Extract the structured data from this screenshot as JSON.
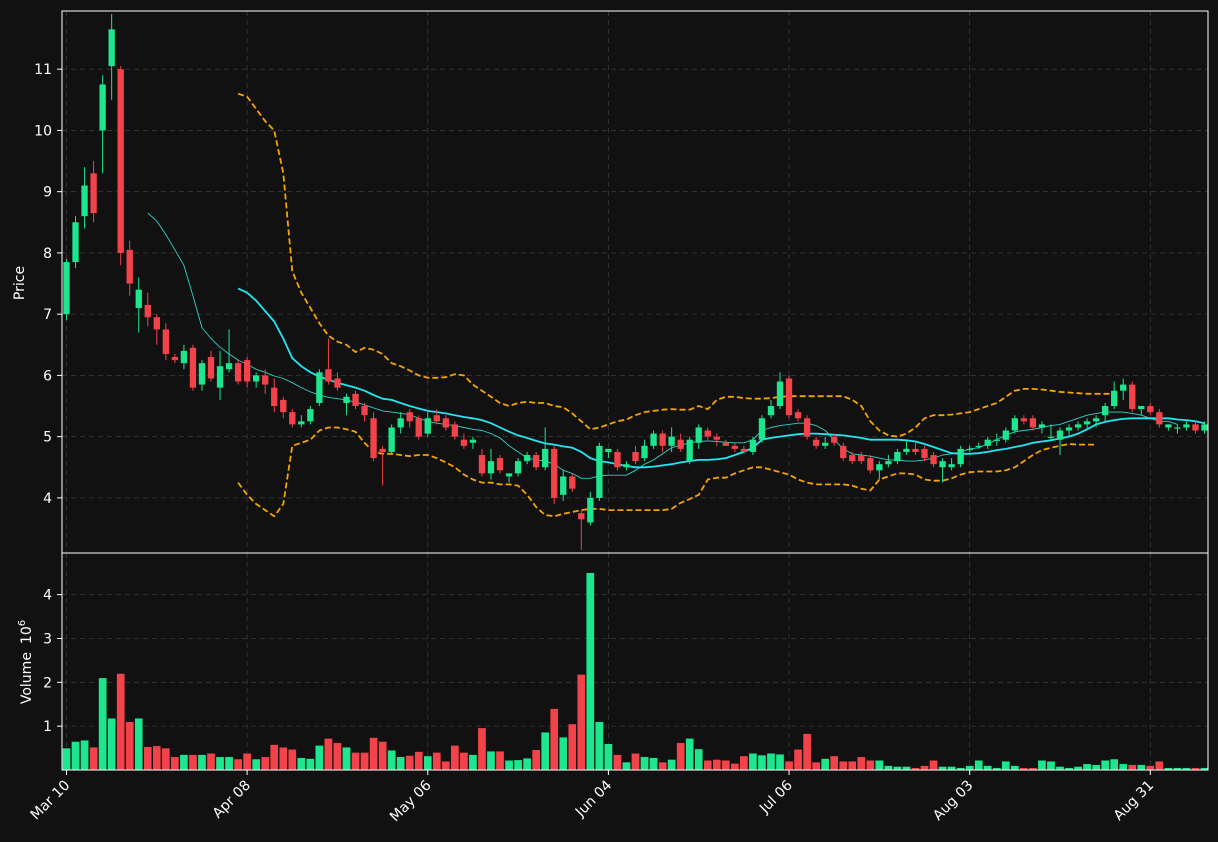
{
  "chart_data": {
    "type": "candlestick",
    "colors": {
      "background": "#111111",
      "grid": "#3a3a3a",
      "axis": "#ffffff",
      "up": "#1de68e",
      "down": "#f2424a",
      "ma_fast": "#2fd3c8",
      "ma_slow": "#22e6f2",
      "band": "#f5a300"
    },
    "price_panel": {
      "ylabel": "Price",
      "ylim": [
        3.1,
        11.95
      ],
      "yticks": [
        4,
        5,
        6,
        7,
        8,
        9,
        10,
        11
      ],
      "grid": true
    },
    "volume_panel": {
      "ylabel": "Volume",
      "ylabel_unit": "10",
      "ylabel_exp": "6",
      "ylim": [
        0,
        4.95
      ],
      "yticks": [
        1,
        2,
        3,
        4
      ],
      "grid": true
    },
    "x_ticks": [
      {
        "index": 0,
        "label": "Mar 10"
      },
      {
        "index": 20,
        "label": "Apr 08"
      },
      {
        "index": 40,
        "label": "May 06"
      },
      {
        "index": 60,
        "label": "Jun 04"
      },
      {
        "index": 80,
        "label": "Jul 06"
      },
      {
        "index": 100,
        "label": "Aug 03"
      },
      {
        "index": 120,
        "label": "Aug 31"
      }
    ],
    "n_bars": 127,
    "ohlc": [
      [
        7.0,
        7.9,
        6.9,
        7.85
      ],
      [
        7.85,
        8.6,
        7.75,
        8.5
      ],
      [
        8.6,
        9.4,
        8.4,
        9.1
      ],
      [
        9.3,
        9.5,
        8.5,
        8.65
      ],
      [
        10.0,
        10.9,
        9.3,
        10.75
      ],
      [
        11.05,
        11.9,
        10.5,
        11.65
      ],
      [
        11.0,
        11.05,
        7.8,
        8.0
      ],
      [
        8.05,
        8.2,
        7.3,
        7.5
      ],
      [
        7.1,
        7.6,
        6.7,
        7.4
      ],
      [
        7.15,
        7.35,
        6.8,
        6.95
      ],
      [
        6.95,
        7.0,
        6.5,
        6.75
      ],
      [
        6.75,
        6.85,
        6.25,
        6.35
      ],
      [
        6.3,
        6.35,
        6.2,
        6.25
      ],
      [
        6.2,
        6.5,
        6.1,
        6.4
      ],
      [
        6.45,
        6.5,
        5.75,
        5.8
      ],
      [
        5.85,
        6.25,
        5.75,
        6.2
      ],
      [
        6.3,
        6.4,
        5.9,
        5.95
      ],
      [
        5.8,
        6.4,
        5.6,
        6.15
      ],
      [
        6.1,
        6.75,
        6.05,
        6.2
      ],
      [
        6.2,
        6.25,
        5.85,
        5.9
      ],
      [
        6.25,
        6.3,
        5.8,
        5.9
      ],
      [
        5.9,
        6.05,
        5.8,
        6.0
      ],
      [
        6.0,
        6.1,
        5.7,
        5.85
      ],
      [
        5.8,
        5.95,
        5.4,
        5.5
      ],
      [
        5.6,
        5.65,
        5.3,
        5.4
      ],
      [
        5.4,
        5.45,
        5.15,
        5.2
      ],
      [
        5.2,
        5.35,
        5.15,
        5.25
      ],
      [
        5.25,
        5.5,
        5.2,
        5.45
      ],
      [
        5.55,
        6.1,
        5.5,
        6.05
      ],
      [
        6.1,
        6.6,
        5.85,
        5.9
      ],
      [
        5.95,
        6.05,
        5.75,
        5.8
      ],
      [
        5.55,
        5.7,
        5.35,
        5.65
      ],
      [
        5.7,
        5.75,
        5.45,
        5.5
      ],
      [
        5.5,
        5.55,
        5.25,
        5.35
      ],
      [
        5.3,
        5.4,
        4.6,
        4.65
      ],
      [
        4.8,
        4.85,
        4.2,
        4.75
      ],
      [
        4.75,
        5.2,
        4.7,
        5.15
      ],
      [
        5.15,
        5.4,
        5.05,
        5.3
      ],
      [
        5.4,
        5.45,
        5.15,
        5.25
      ],
      [
        5.3,
        5.35,
        4.95,
        5.0
      ],
      [
        5.05,
        5.4,
        5.0,
        5.3
      ],
      [
        5.35,
        5.45,
        5.2,
        5.25
      ],
      [
        5.3,
        5.35,
        5.1,
        5.15
      ],
      [
        5.2,
        5.25,
        4.95,
        5.0
      ],
      [
        4.95,
        5.05,
        4.8,
        4.85
      ],
      [
        4.9,
        5.0,
        4.8,
        4.95
      ],
      [
        4.7,
        4.8,
        4.35,
        4.4
      ],
      [
        4.4,
        4.8,
        4.3,
        4.6
      ],
      [
        4.65,
        4.7,
        4.4,
        4.45
      ],
      [
        4.35,
        4.4,
        4.25,
        4.4
      ],
      [
        4.4,
        4.65,
        4.35,
        4.6
      ],
      [
        4.6,
        4.75,
        4.55,
        4.7
      ],
      [
        4.7,
        4.75,
        4.45,
        4.5
      ],
      [
        4.5,
        5.15,
        4.45,
        4.8
      ],
      [
        4.8,
        4.85,
        3.9,
        4.0
      ],
      [
        4.05,
        4.45,
        3.95,
        4.35
      ],
      [
        4.35,
        4.4,
        4.1,
        4.15
      ],
      [
        3.75,
        3.8,
        3.15,
        3.65
      ],
      [
        3.6,
        4.1,
        3.55,
        4.0
      ],
      [
        4.0,
        4.9,
        3.95,
        4.85
      ],
      [
        4.75,
        4.8,
        4.65,
        4.8
      ],
      [
        4.75,
        4.8,
        4.45,
        4.5
      ],
      [
        4.5,
        4.6,
        4.45,
        4.55
      ],
      [
        4.75,
        4.85,
        4.55,
        4.6
      ],
      [
        4.65,
        4.95,
        4.6,
        4.85
      ],
      [
        4.85,
        5.1,
        4.8,
        5.05
      ],
      [
        5.05,
        5.1,
        4.75,
        4.85
      ],
      [
        4.85,
        5.15,
        4.75,
        5.0
      ],
      [
        4.95,
        5.05,
        4.75,
        4.8
      ],
      [
        4.6,
        5.0,
        4.55,
        4.95
      ],
      [
        4.9,
        5.2,
        4.8,
        5.15
      ],
      [
        5.1,
        5.15,
        4.95,
        5.0
      ],
      [
        5.0,
        5.05,
        4.85,
        4.95
      ],
      [
        4.9,
        4.95,
        4.85,
        4.85
      ],
      [
        4.85,
        4.9,
        4.75,
        4.8
      ],
      [
        4.8,
        4.85,
        4.75,
        4.75
      ],
      [
        4.75,
        5.0,
        4.7,
        4.95
      ],
      [
        4.95,
        5.35,
        4.9,
        5.3
      ],
      [
        5.35,
        5.6,
        5.3,
        5.5
      ],
      [
        5.5,
        6.05,
        5.45,
        5.9
      ],
      [
        5.95,
        6.0,
        5.3,
        5.35
      ],
      [
        5.4,
        5.45,
        5.25,
        5.3
      ],
      [
        5.3,
        5.35,
        4.95,
        5.0
      ],
      [
        4.95,
        5.0,
        4.8,
        4.85
      ],
      [
        4.85,
        5.0,
        4.8,
        4.9
      ],
      [
        5.0,
        5.05,
        4.85,
        4.9
      ],
      [
        4.85,
        4.9,
        4.6,
        4.65
      ],
      [
        4.7,
        4.75,
        4.55,
        4.6
      ],
      [
        4.7,
        4.75,
        4.55,
        4.6
      ],
      [
        4.65,
        4.7,
        4.4,
        4.45
      ],
      [
        4.45,
        4.6,
        4.3,
        4.55
      ],
      [
        4.55,
        4.7,
        4.5,
        4.6
      ],
      [
        4.6,
        4.8,
        4.55,
        4.75
      ],
      [
        4.75,
        4.95,
        4.7,
        4.8
      ],
      [
        4.8,
        4.9,
        4.7,
        4.75
      ],
      [
        4.8,
        4.85,
        4.6,
        4.65
      ],
      [
        4.7,
        4.75,
        4.5,
        4.55
      ],
      [
        4.5,
        4.65,
        4.25,
        4.6
      ],
      [
        4.5,
        4.65,
        4.45,
        4.55
      ],
      [
        4.55,
        4.85,
        4.5,
        4.8
      ],
      [
        4.8,
        4.85,
        4.75,
        4.8
      ],
      [
        4.85,
        4.9,
        4.8,
        4.85
      ],
      [
        4.85,
        5.0,
        4.8,
        4.95
      ],
      [
        4.95,
        5.05,
        4.85,
        4.95
      ],
      [
        4.95,
        5.15,
        4.9,
        5.1
      ],
      [
        5.1,
        5.35,
        5.05,
        5.3
      ],
      [
        5.3,
        5.35,
        5.2,
        5.25
      ],
      [
        5.3,
        5.35,
        5.1,
        5.15
      ],
      [
        5.15,
        5.25,
        5.05,
        5.2
      ],
      [
        5.0,
        5.2,
        4.95,
        5.0
      ],
      [
        4.95,
        5.15,
        4.7,
        5.1
      ],
      [
        5.1,
        5.2,
        5.0,
        5.15
      ],
      [
        5.15,
        5.25,
        5.1,
        5.2
      ],
      [
        5.2,
        5.3,
        5.1,
        5.25
      ],
      [
        5.25,
        5.35,
        5.15,
        5.3
      ],
      [
        5.35,
        5.55,
        5.25,
        5.5
      ],
      [
        5.5,
        5.9,
        5.45,
        5.75
      ],
      [
        5.75,
        5.95,
        5.6,
        5.85
      ],
      [
        5.85,
        5.9,
        5.4,
        5.45
      ],
      [
        5.45,
        5.5,
        5.35,
        5.5
      ],
      [
        5.5,
        5.55,
        5.35,
        5.4
      ],
      [
        5.4,
        5.45,
        5.15,
        5.2
      ],
      [
        5.15,
        5.2,
        5.1,
        5.2
      ],
      [
        5.15,
        5.2,
        5.05,
        5.15
      ],
      [
        5.15,
        5.25,
        5.1,
        5.2
      ],
      [
        5.2,
        5.25,
        5.05,
        5.1
      ],
      [
        5.1,
        5.25,
        5.05,
        5.2
      ]
    ],
    "volume": [
      0.5,
      0.65,
      0.68,
      0.52,
      2.1,
      1.18,
      2.2,
      1.1,
      1.18,
      0.53,
      0.55,
      0.5,
      0.3,
      0.35,
      0.35,
      0.35,
      0.38,
      0.3,
      0.3,
      0.25,
      0.38,
      0.25,
      0.3,
      0.58,
      0.52,
      0.47,
      0.28,
      0.26,
      0.56,
      0.72,
      0.62,
      0.52,
      0.4,
      0.4,
      0.74,
      0.65,
      0.45,
      0.3,
      0.33,
      0.42,
      0.32,
      0.4,
      0.2,
      0.56,
      0.4,
      0.35,
      0.96,
      0.43,
      0.43,
      0.22,
      0.23,
      0.27,
      0.46,
      0.86,
      1.4,
      0.75,
      1.05,
      2.18,
      4.5,
      1.1,
      0.6,
      0.35,
      0.18,
      0.38,
      0.3,
      0.28,
      0.18,
      0.24,
      0.62,
      0.72,
      0.48,
      0.22,
      0.24,
      0.22,
      0.15,
      0.32,
      0.38,
      0.34,
      0.38,
      0.36,
      0.2,
      0.47,
      0.83,
      0.18,
      0.26,
      0.32,
      0.2,
      0.2,
      0.3,
      0.22,
      0.22,
      0.1,
      0.08,
      0.08,
      0.05,
      0.1,
      0.22,
      0.08,
      0.08,
      0.05,
      0.1,
      0.22,
      0.1,
      0.05,
      0.2,
      0.1,
      0.05,
      0.05,
      0.22,
      0.2,
      0.08,
      0.05,
      0.08,
      0.14,
      0.12,
      0.22,
      0.25,
      0.14,
      0.12,
      0.12,
      0.1,
      0.2,
      0.05,
      0.05,
      0.05,
      0.05,
      0.05
    ],
    "ma_fast": {
      "start": 9,
      "values": [
        8.65,
        8.52,
        8.3,
        8.05,
        7.8,
        7.3,
        6.78,
        6.6,
        6.46,
        6.35,
        6.25,
        6.18,
        6.1,
        6.05,
        5.99,
        5.95,
        5.88,
        5.8,
        5.73,
        5.68,
        5.64,
        5.62,
        5.6,
        5.56,
        5.52,
        5.47,
        5.42,
        5.4,
        5.38,
        5.36,
        5.3,
        5.25,
        5.22,
        5.2,
        5.18,
        5.15,
        5.12,
        5.1,
        5.05,
        4.98,
        4.85,
        4.75,
        4.65,
        4.62,
        4.6,
        4.55,
        4.45,
        4.4,
        4.32,
        4.32,
        4.36,
        4.37,
        4.37,
        4.37,
        4.45,
        4.55,
        4.62,
        4.72,
        4.82,
        4.86,
        4.9,
        4.92,
        4.93,
        4.92,
        4.91,
        4.9,
        4.9,
        4.95,
        5.1,
        5.15,
        5.18,
        5.2,
        5.22,
        5.22,
        5.18,
        5.1,
        4.95,
        4.8,
        4.72,
        4.7,
        4.68,
        4.65,
        4.62,
        4.62,
        4.6,
        4.6,
        4.62,
        4.65,
        4.7,
        4.72,
        4.75,
        4.8,
        4.82,
        4.88,
        4.95,
        5.02,
        5.08,
        5.1,
        5.12,
        5.15,
        5.18,
        5.2,
        5.25,
        5.3,
        5.35,
        5.38,
        5.4,
        5.4,
        5.4,
        5.38,
        5.35,
        5.3,
        5.25,
        5.25,
        5.2
      ]
    },
    "ma_slow": {
      "start": 19,
      "values": [
        7.42,
        7.35,
        7.22,
        7.05,
        6.88,
        6.6,
        6.28,
        6.15,
        6.05,
        5.98,
        5.93,
        5.88,
        5.84,
        5.8,
        5.75,
        5.68,
        5.62,
        5.6,
        5.55,
        5.5,
        5.46,
        5.42,
        5.4,
        5.38,
        5.35,
        5.32,
        5.3,
        5.27,
        5.22,
        5.15,
        5.08,
        5.02,
        4.98,
        4.93,
        4.89,
        4.87,
        4.84,
        4.82,
        4.75,
        4.65,
        4.6,
        4.58,
        4.55,
        4.52,
        4.5,
        4.5,
        4.51,
        4.53,
        4.55,
        4.58,
        4.6,
        4.62,
        4.62,
        4.63,
        4.65,
        4.7,
        4.75,
        4.82,
        4.95,
        4.98,
        5.0,
        5.02,
        5.04,
        5.05,
        5.05,
        5.04,
        5.03,
        5.02,
        5.0,
        4.98,
        4.95,
        4.95,
        4.95,
        4.95,
        4.94,
        4.92,
        4.88,
        4.83,
        4.78,
        4.73,
        4.72,
        4.72,
        4.73,
        4.75,
        4.78,
        4.8,
        4.83,
        4.86,
        4.9,
        4.92,
        4.94,
        4.97,
        5.0,
        5.05,
        5.12,
        5.2,
        5.24,
        5.27,
        5.29,
        5.3,
        5.3,
        5.3,
        5.3,
        5.3,
        5.28,
        5.27,
        5.25,
        5.22
      ]
    },
    "band_upper": {
      "start": 19,
      "values": [
        10.6,
        10.55,
        10.35,
        10.15,
        10.0,
        9.3,
        7.7,
        7.35,
        7.1,
        6.85,
        6.65,
        6.55,
        6.5,
        6.38,
        6.45,
        6.42,
        6.35,
        6.2,
        6.15,
        6.08,
        6.0,
        5.96,
        5.96,
        5.97,
        6.02,
        6.0,
        5.85,
        5.75,
        5.65,
        5.55,
        5.5,
        5.55,
        5.57,
        5.55,
        5.55,
        5.5,
        5.48,
        5.38,
        5.25,
        5.12,
        5.15,
        5.2,
        5.25,
        5.28,
        5.35,
        5.4,
        5.42,
        5.44,
        5.45,
        5.44,
        5.44,
        5.5,
        5.45,
        5.6,
        5.65,
        5.65,
        5.63,
        5.62,
        5.62,
        5.63,
        5.65,
        5.66,
        5.66,
        5.66,
        5.66,
        5.66,
        5.66,
        5.66,
        5.6,
        5.5,
        5.25,
        5.1,
        5.02,
        5.0,
        5.05,
        5.15,
        5.3,
        5.35,
        5.35,
        5.36,
        5.38,
        5.4,
        5.45,
        5.5,
        5.55,
        5.65,
        5.75,
        5.78,
        5.78,
        5.77,
        5.75,
        5.73,
        5.72,
        5.71,
        5.7,
        5.7,
        5.7,
        5.7
      ]
    },
    "band_lower": {
      "start": 19,
      "values": [
        4.25,
        4.05,
        3.9,
        3.8,
        3.7,
        3.9,
        4.85,
        4.9,
        4.95,
        5.1,
        5.15,
        5.15,
        5.12,
        5.08,
        4.9,
        4.75,
        4.72,
        4.72,
        4.7,
        4.68,
        4.7,
        4.7,
        4.65,
        4.58,
        4.5,
        4.38,
        4.3,
        4.25,
        4.25,
        4.22,
        4.22,
        4.2,
        4.05,
        3.85,
        3.72,
        3.7,
        3.74,
        3.77,
        3.8,
        3.82,
        3.82,
        3.8,
        3.8,
        3.8,
        3.8,
        3.8,
        3.8,
        3.8,
        3.82,
        3.92,
        3.98,
        4.05,
        4.3,
        4.33,
        4.33,
        4.4,
        4.45,
        4.5,
        4.5,
        4.46,
        4.42,
        4.38,
        4.3,
        4.25,
        4.22,
        4.22,
        4.22,
        4.22,
        4.2,
        4.15,
        4.12,
        4.3,
        4.35,
        4.4,
        4.4,
        4.38,
        4.3,
        4.28,
        4.28,
        4.32,
        4.38,
        4.42,
        4.43,
        4.43,
        4.43,
        4.45,
        4.5,
        4.6,
        4.7,
        4.78,
        4.82,
        4.85,
        4.88,
        4.87,
        4.87,
        4.87
      ]
    }
  }
}
